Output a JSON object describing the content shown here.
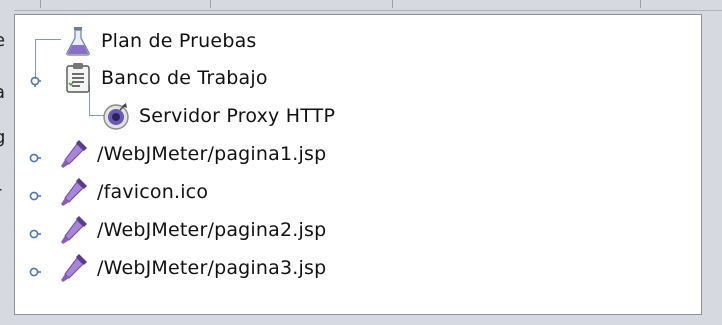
{
  "tree": {
    "nodes": [
      {
        "label": "Plan de Pruebas",
        "icon": "flask-icon"
      },
      {
        "label": "Banco de Trabajo",
        "icon": "clipboard-icon"
      },
      {
        "label": "Servidor Proxy HTTP",
        "icon": "proxy-icon"
      },
      {
        "label": "/WebJMeter/pagina1.jsp",
        "icon": "dropper-icon"
      },
      {
        "label": "/favicon.ico",
        "icon": "dropper-icon"
      },
      {
        "label": "/WebJMeter/pagina2.jsp",
        "icon": "dropper-icon"
      },
      {
        "label": "/WebJMeter/pagina3.jsp",
        "icon": "dropper-icon"
      }
    ]
  },
  "colors": {
    "connector": "#7a9ac4",
    "panel_bg": "#ffffff",
    "chrome_bg": "#d6d9df",
    "sampler_purple": "#8a5cc0"
  }
}
